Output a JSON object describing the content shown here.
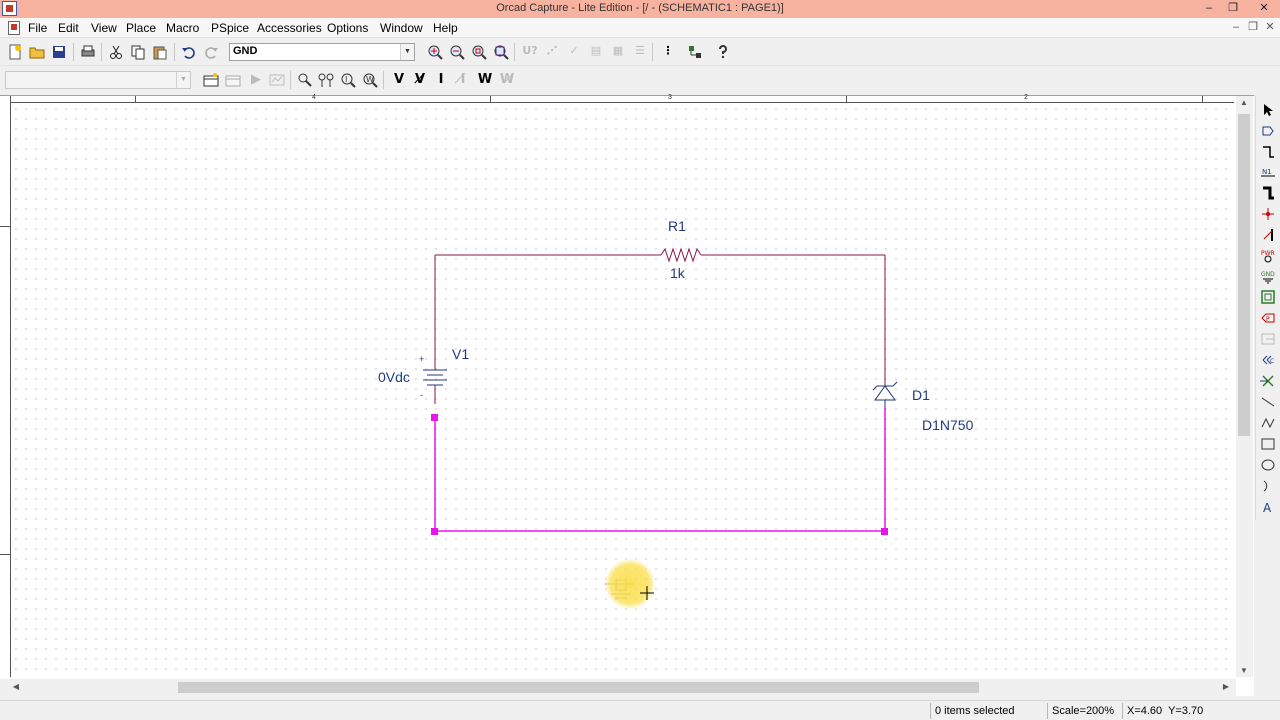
{
  "window": {
    "title": "Orcad Capture - Lite Edition - [/ - (SCHEMATIC1 : PAGE1)]",
    "minimize": "–",
    "maximize": "❐",
    "close": "✕"
  },
  "menu": {
    "items": [
      "File",
      "Edit",
      "View",
      "Place",
      "Macro",
      "PSpice",
      "Accessories",
      "Options",
      "Window",
      "Help"
    ]
  },
  "toolbar": {
    "part_combo_value": "GND",
    "part_combo_arrow": "▼",
    "secondary_combo_value": ""
  },
  "ruler": {
    "labels": [
      "4",
      "3",
      "2"
    ]
  },
  "schematic": {
    "r1_ref": "R1",
    "r1_value": "1k",
    "v1_ref": "V1",
    "v1_value": "0Vdc",
    "v1_plus": "+",
    "v1_minus": "-",
    "d1_ref": "D1",
    "d1_value": "D1N750",
    "wire_color": "#8a1a4a",
    "selected_wire_color": "#e815e8"
  },
  "status": {
    "selection": "0 items selected",
    "scale": "Scale=200%",
    "coords": "X=4.60  Y=3.70"
  }
}
